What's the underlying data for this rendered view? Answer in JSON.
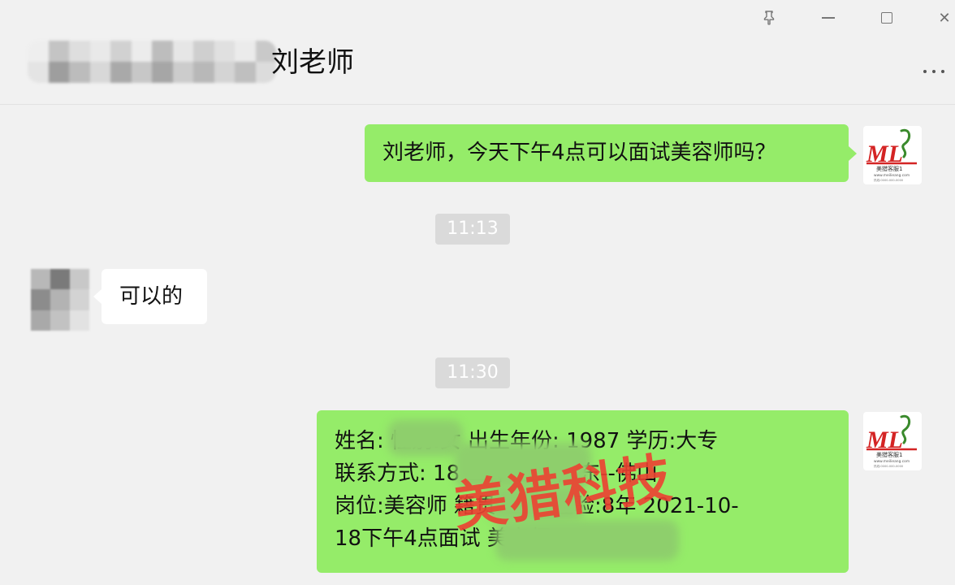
{
  "window": {
    "pin_icon": "pin-icon",
    "minimize_icon": "minimize-icon",
    "maximize_icon": "maximize-icon",
    "close_icon": "close-icon",
    "close_glyph": "✕"
  },
  "header": {
    "contact_name": "刘老师",
    "name_redacted": true,
    "more_icon": "more-dots-icon"
  },
  "messages": [
    {
      "direction": "out",
      "text": "刘老师，今天下午4点可以面试美容师吗？"
    },
    {
      "type": "time",
      "text": "11:13"
    },
    {
      "direction": "in",
      "text": "可以的"
    },
    {
      "type": "time",
      "text": "11:30"
    },
    {
      "direction": "out",
      "lines": [
        "姓名:        性别:女 出生年份: 1987 学历:大专",
        "联系方式: 18             工作地点:广东--佛山",
        "岗位:美容师 籍贯:       工作经验:8年 2021-10-",
        "18下午4点面试                    美容师"
      ]
    }
  ],
  "avatar": {
    "logo_text": "ML",
    "logo_caption": "美猎客服1",
    "logo_url": "www.meilieang.com",
    "logo_small": "热线:0000-000-0000"
  },
  "watermark": {
    "text": "美猎科技"
  },
  "colors": {
    "background": "#f1f1f1",
    "outgoing_bubble": "#95ec69",
    "incoming_bubble": "#ffffff",
    "time_tag": "#dadada",
    "watermark": "#ec4032",
    "logo_red": "#d42424",
    "logo_green": "#3a8a2c"
  }
}
